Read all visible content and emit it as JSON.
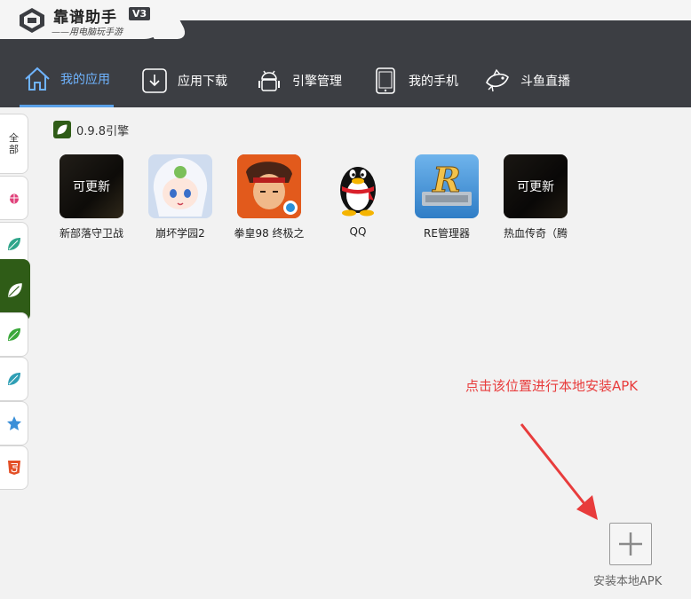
{
  "app": {
    "name": "靠谱助手",
    "version": "V3",
    "slogan": "——用电脑玩手游"
  },
  "nav": {
    "items": [
      {
        "label": "我的应用",
        "icon": "home-icon",
        "active": true
      },
      {
        "label": "应用下载",
        "icon": "download-icon",
        "active": false
      },
      {
        "label": "引擎管理",
        "icon": "android-icon",
        "active": false
      },
      {
        "label": "我的手机",
        "icon": "phone-icon",
        "active": false
      },
      {
        "label": "斗鱼直播",
        "icon": "douyu-fish-icon",
        "active": false
      }
    ],
    "accent": "#5aa0e8"
  },
  "sidebar": {
    "tabs": [
      {
        "label": "全部",
        "icon": "text-all",
        "active": false
      },
      {
        "icon": "bug-icon",
        "color": "#e0407a",
        "active": false
      },
      {
        "icon": "leaf-icon",
        "color": "#2fa58a",
        "active": false
      },
      {
        "icon": "leaf-icon",
        "color": "#ffffff",
        "active": true
      },
      {
        "icon": "leaf-icon",
        "color": "#3aa83a",
        "active": false
      },
      {
        "icon": "leaf-icon",
        "color": "#2f9fb5",
        "active": false
      },
      {
        "icon": "star-icon",
        "color": "#3a8fd8",
        "active": false
      },
      {
        "icon": "html5-icon",
        "color": "#e34f26",
        "active": false
      }
    ]
  },
  "engine": {
    "label": "0.9.8引擎",
    "color": "#2f5c17"
  },
  "apps": [
    {
      "name": "新部落守卫战",
      "update_label": "可更新",
      "has_update": true
    },
    {
      "name": "崩坏学园2",
      "update_label": "",
      "has_update": false
    },
    {
      "name": "拳皇98 终极之",
      "update_label": "",
      "has_update": false
    },
    {
      "name": "QQ",
      "update_label": "",
      "has_update": false
    },
    {
      "name": "RE管理器",
      "update_label": "",
      "has_update": false
    },
    {
      "name": "热血传奇（腾",
      "update_label": "可更新",
      "has_update": true
    }
  ],
  "hint": {
    "text": "点击该位置进行本地安装APK",
    "color": "#e83c3c"
  },
  "install": {
    "label": "安装本地APK"
  }
}
